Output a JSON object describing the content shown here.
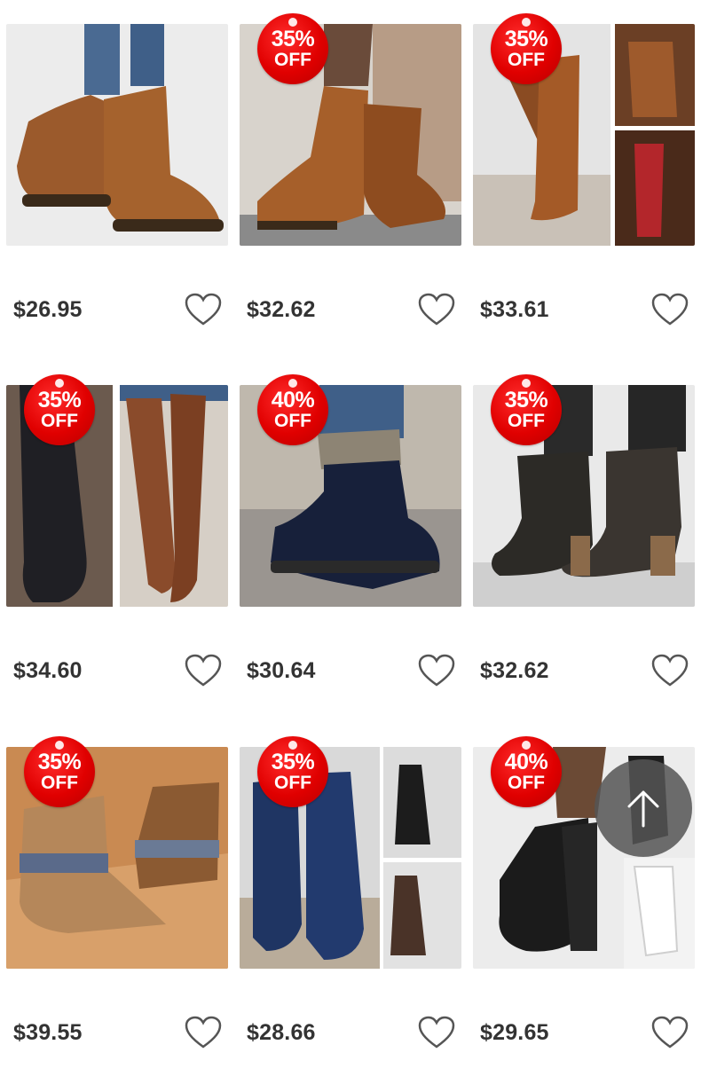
{
  "products": [
    {
      "price": "$26.95",
      "badge": null,
      "icon": "heart-icon"
    },
    {
      "price": "$32.62",
      "badge": {
        "percent": "35%",
        "off": "OFF"
      },
      "icon": "heart-icon"
    },
    {
      "price": "$33.61",
      "badge": {
        "percent": "35%",
        "off": "OFF"
      },
      "icon": "heart-icon"
    },
    {
      "price": "$34.60",
      "badge": {
        "percent": "35%",
        "off": "OFF"
      },
      "icon": "heart-icon"
    },
    {
      "price": "$30.64",
      "badge": {
        "percent": "40%",
        "off": "OFF"
      },
      "icon": "heart-icon"
    },
    {
      "price": "$32.62",
      "badge": {
        "percent": "35%",
        "off": "OFF"
      },
      "icon": "heart-icon"
    },
    {
      "price": "$39.55",
      "badge": {
        "percent": "35%",
        "off": "OFF"
      },
      "icon": "heart-icon"
    },
    {
      "price": "$28.66",
      "badge": {
        "percent": "35%",
        "off": "OFF"
      },
      "icon": "heart-icon"
    },
    {
      "price": "$29.65",
      "badge": {
        "percent": "40%",
        "off": "OFF"
      },
      "icon": "heart-icon"
    }
  ],
  "scroll_top_button": {
    "icon": "arrow-up-icon"
  },
  "colors": {
    "badge_red": "#e00000",
    "price_text": "#333333",
    "heart_outline": "#555555",
    "scroll_button_bg": "#555555"
  }
}
